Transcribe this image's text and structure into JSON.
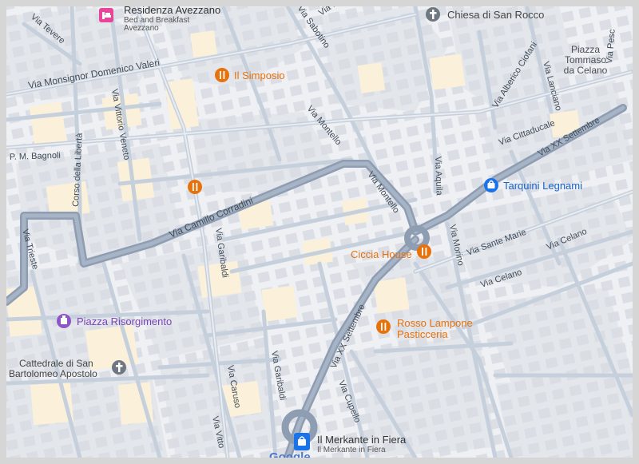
{
  "streets": {
    "tevere": "Via Tevere",
    "pm_top": "Via P. M.",
    "sabotino": "Via Sabotino",
    "monsignor": "Via Monsignor Domenico Valeri",
    "vittorio_veneto": "Via Vittorio Veneto",
    "corso_liberta": "Corso della Libertà",
    "pm_bagnoli": "P. M. Bagnoli",
    "montello_upper": "Via Montello",
    "montello_lower": "Via Montello",
    "camillo_corradini": "Via Camillo Corradini",
    "trieste": "Via Trieste",
    "garibaldi_upper": "Via Garibaldi",
    "garibaldi_lower": "Via Garibaldi",
    "aquila": "Via Aquila",
    "xx_settembre_ne": "Via XX Settembre",
    "xx_settembre_sw": "Via XX Settembre",
    "morino": "Via Morino",
    "sante_marie": "Via Sante Marie",
    "celano_a": "Via Celano",
    "celano_b": "Via Celano",
    "alberico_ciofani": "Via Alberico Ciofani",
    "lanciano": "Via Lanciano",
    "cittaducale": "Via Cittaducale",
    "pesc": "Via Pesc",
    "caruso": "Via Caruso",
    "cupello": "Via Cupello",
    "vitto_bottom": "Via Vitto"
  },
  "pois": {
    "residenza": {
      "name": "Residenza Avezzano",
      "sub1": "Bed and Breakfast",
      "sub2": "Avezzano"
    },
    "chiesa": {
      "name": "Chiesa di San Rocco"
    },
    "piazza_tommaso": {
      "line1": "Piazza",
      "line2": "Tommaso",
      "line3": "da Celano"
    },
    "simposio": {
      "name": "Il Simposio"
    },
    "tarquini": {
      "name": "Tarquini Legnami"
    },
    "ciccia": {
      "name": "Ciccia House"
    },
    "rosso": {
      "line1": "Rosso Lampone",
      "line2": "Pasticceria"
    },
    "piazza_risorgimento": {
      "name": "Piazza Risorgimento"
    },
    "cattedrale": {
      "line1": "Cattedrale di San",
      "line2": "Bartolomeo Apostolo"
    },
    "merkante": {
      "name": "Il Merkante in Fiera",
      "sub": "Il Merkante in Fiera"
    }
  },
  "branding": {
    "logo": "Google"
  },
  "colors": {
    "background": "#eef0f3",
    "block": "#e2e5ea",
    "building": "#dadde3",
    "beige": "#fbf1da",
    "street": "#c4cfdc",
    "main_road": "#8a9bb1",
    "restaurant": "#e8710a",
    "shop": "#1a73e8",
    "lodging": "#e8449a",
    "landmark": "#8e55c9",
    "church": "#6f7780",
    "label_text": "#3c4043"
  },
  "icons": {
    "restaurant": "fork-knife-icon",
    "shop": "shopping-bag-icon",
    "lodging": "bed-icon",
    "landmark": "monument-icon",
    "church": "cross-icon"
  }
}
